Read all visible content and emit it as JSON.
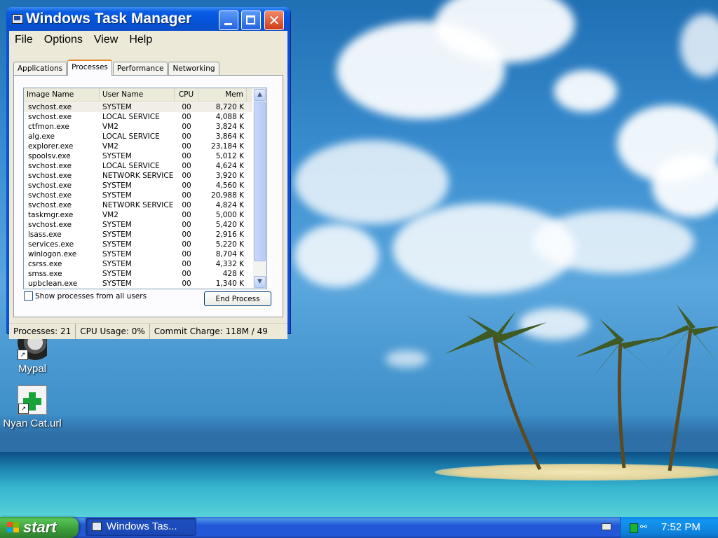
{
  "window": {
    "title": "Windows Task Manager",
    "menu": [
      "File",
      "Options",
      "View",
      "Help"
    ],
    "tabs": [
      "Applications",
      "Processes",
      "Performance",
      "Networking"
    ],
    "active_tab": "Processes",
    "columns": [
      "Image Name",
      "User Name",
      "CPU",
      "Mem Usage"
    ],
    "processes": [
      [
        "svchost.exe",
        "SYSTEM",
        "00",
        "8,720 K"
      ],
      [
        "svchost.exe",
        "LOCAL SERVICE",
        "00",
        "4,088 K"
      ],
      [
        "ctfmon.exe",
        "VM2",
        "00",
        "3,824 K"
      ],
      [
        "alg.exe",
        "LOCAL SERVICE",
        "00",
        "3,864 K"
      ],
      [
        "explorer.exe",
        "VM2",
        "00",
        "23,184 K"
      ],
      [
        "spoolsv.exe",
        "SYSTEM",
        "00",
        "5,012 K"
      ],
      [
        "svchost.exe",
        "LOCAL SERVICE",
        "00",
        "4,624 K"
      ],
      [
        "svchost.exe",
        "NETWORK SERVICE",
        "00",
        "3,920 K"
      ],
      [
        "svchost.exe",
        "SYSTEM",
        "00",
        "4,560 K"
      ],
      [
        "svchost.exe",
        "SYSTEM",
        "00",
        "20,988 K"
      ],
      [
        "svchost.exe",
        "NETWORK SERVICE",
        "00",
        "4,824 K"
      ],
      [
        "taskmgr.exe",
        "VM2",
        "00",
        "5,000 K"
      ],
      [
        "svchost.exe",
        "SYSTEM",
        "00",
        "5,420 K"
      ],
      [
        "lsass.exe",
        "SYSTEM",
        "00",
        "2,916 K"
      ],
      [
        "services.exe",
        "SYSTEM",
        "00",
        "5,220 K"
      ],
      [
        "winlogon.exe",
        "SYSTEM",
        "00",
        "8,704 K"
      ],
      [
        "csrss.exe",
        "SYSTEM",
        "00",
        "4,332 K"
      ],
      [
        "smss.exe",
        "SYSTEM",
        "00",
        "428 K"
      ],
      [
        "upbclean.exe",
        "SYSTEM",
        "00",
        "1,340 K"
      ]
    ],
    "show_all_label": "Show processes from all users",
    "show_all_checked": false,
    "end_process_label": "End Process",
    "status": {
      "processes": "Processes: 21",
      "cpu": "CPU Usage: 0%",
      "commit": "Commit Charge: 118M / 49"
    }
  },
  "desktop_icons": [
    {
      "label": "Mypal",
      "icon": "mypal-icon"
    },
    {
      "label": "Nyan Cat.url",
      "icon": "url-shortcut-icon"
    }
  ],
  "taskbar": {
    "start_label": "start",
    "task_button_label": "Windows Tas...",
    "clock": "7:52 PM"
  },
  "colors": {
    "title_blue": "#0453d8",
    "start_green": "#3a9c3a",
    "taskbar_blue": "#2359d8",
    "tab_highlight": "#e68b2c"
  }
}
